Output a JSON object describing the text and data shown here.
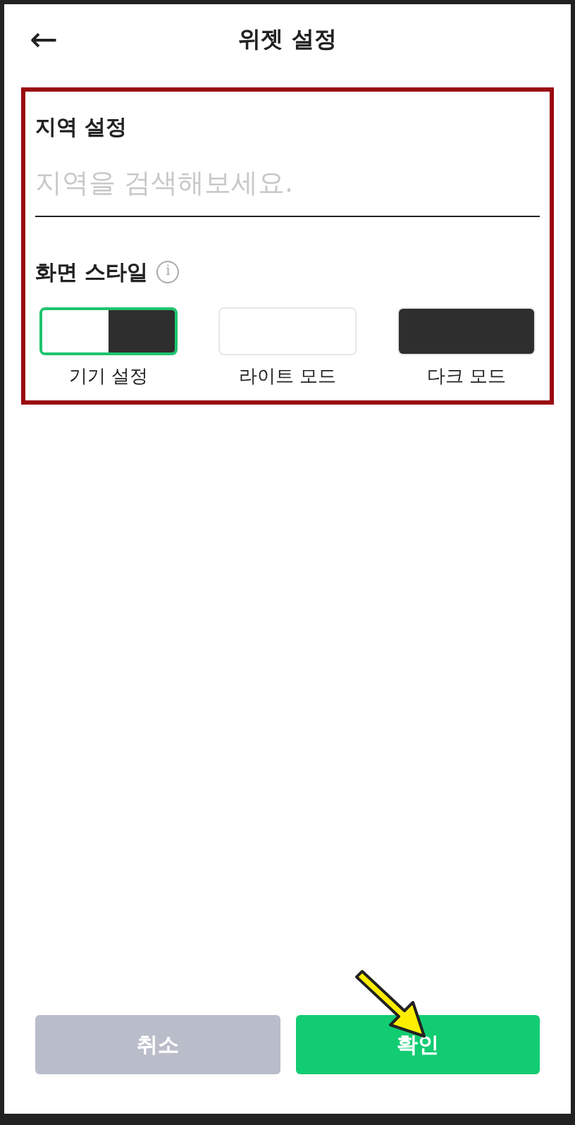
{
  "header": {
    "back": "←",
    "title": "위젯 설정"
  },
  "region": {
    "label": "지역 설정",
    "placeholder": "지역을 검색해보세요."
  },
  "style": {
    "label": "화면 스타일",
    "info": "i",
    "options": [
      {
        "kind": "split",
        "label": "기기 설정",
        "selected": true
      },
      {
        "kind": "light",
        "label": "라이트 모드",
        "selected": false
      },
      {
        "kind": "dark",
        "label": "다크 모드",
        "selected": false
      }
    ]
  },
  "buttons": [
    {
      "kind": "cancel",
      "label": "취소"
    },
    {
      "kind": "confirm",
      "label": "확인"
    }
  ]
}
